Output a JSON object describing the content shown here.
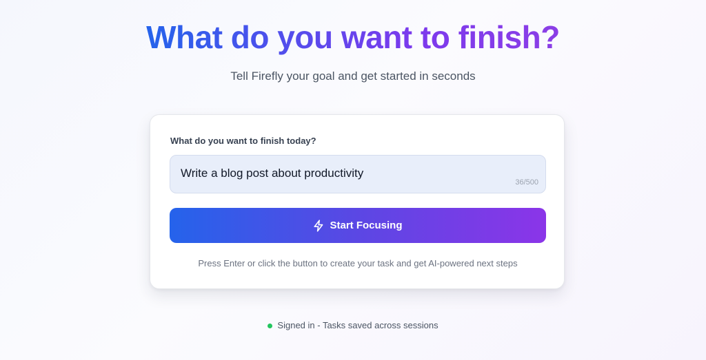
{
  "hero": {
    "title": "What do you want to finish?",
    "subtitle": "Tell Firefly your goal and get started in seconds"
  },
  "form": {
    "label": "What do you want to finish today?",
    "input_value": "Write a blog post about productivity",
    "char_count": "36/500",
    "button_label": "Start Focusing",
    "button_icon": "lightning-bolt-icon",
    "hint": "Press Enter or click the button to create your task and get AI-powered next steps"
  },
  "status": {
    "text": "Signed in - Tasks saved across sessions",
    "indicator_color": "#22c55e"
  },
  "colors": {
    "gradient_start": "#2563eb",
    "gradient_end": "#8b35e8"
  }
}
